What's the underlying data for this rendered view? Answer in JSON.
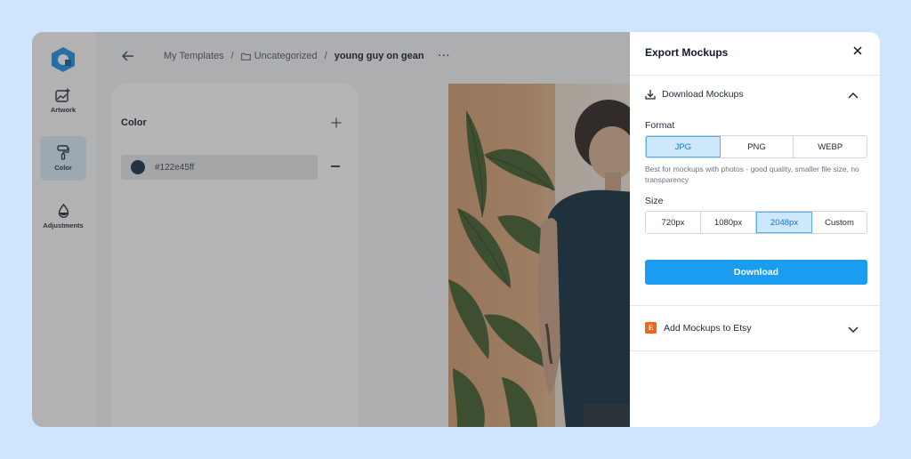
{
  "breadcrumb": {
    "root": "My Templates",
    "folder": "Uncategorized",
    "current": "young guy on gean",
    "more": "···"
  },
  "rail": {
    "items": [
      {
        "label": "Artwork",
        "icon": "image-plus-icon"
      },
      {
        "label": "Color",
        "icon": "paint-roller-icon",
        "active": true
      },
      {
        "label": "Adjustments",
        "icon": "droplet-icon"
      }
    ]
  },
  "color_panel": {
    "title": "Color",
    "entries": [
      {
        "hex": "#122e45ff",
        "swatch": "#122e45"
      }
    ]
  },
  "export": {
    "title": "Export Mockups",
    "download_section": "Download Mockups",
    "format_label": "Format",
    "formats": [
      "JPG",
      "PNG",
      "WEBP"
    ],
    "selected_format": "JPG",
    "format_hint": "Best for mockups with photos - good quality, smaller file size, no transparency",
    "size_label": "Size",
    "sizes": [
      "720px",
      "1080px",
      "2048px",
      "Custom"
    ],
    "selected_size": "2048px",
    "download_button": "Download",
    "etsy_section": "Add Mockups to Etsy",
    "etsy_badge": "E"
  },
  "colors": {
    "accent": "#1a9cf0",
    "selected_bg": "#cde8fb",
    "etsy": "#f1641e",
    "backdrop": "#cfe5fb"
  }
}
